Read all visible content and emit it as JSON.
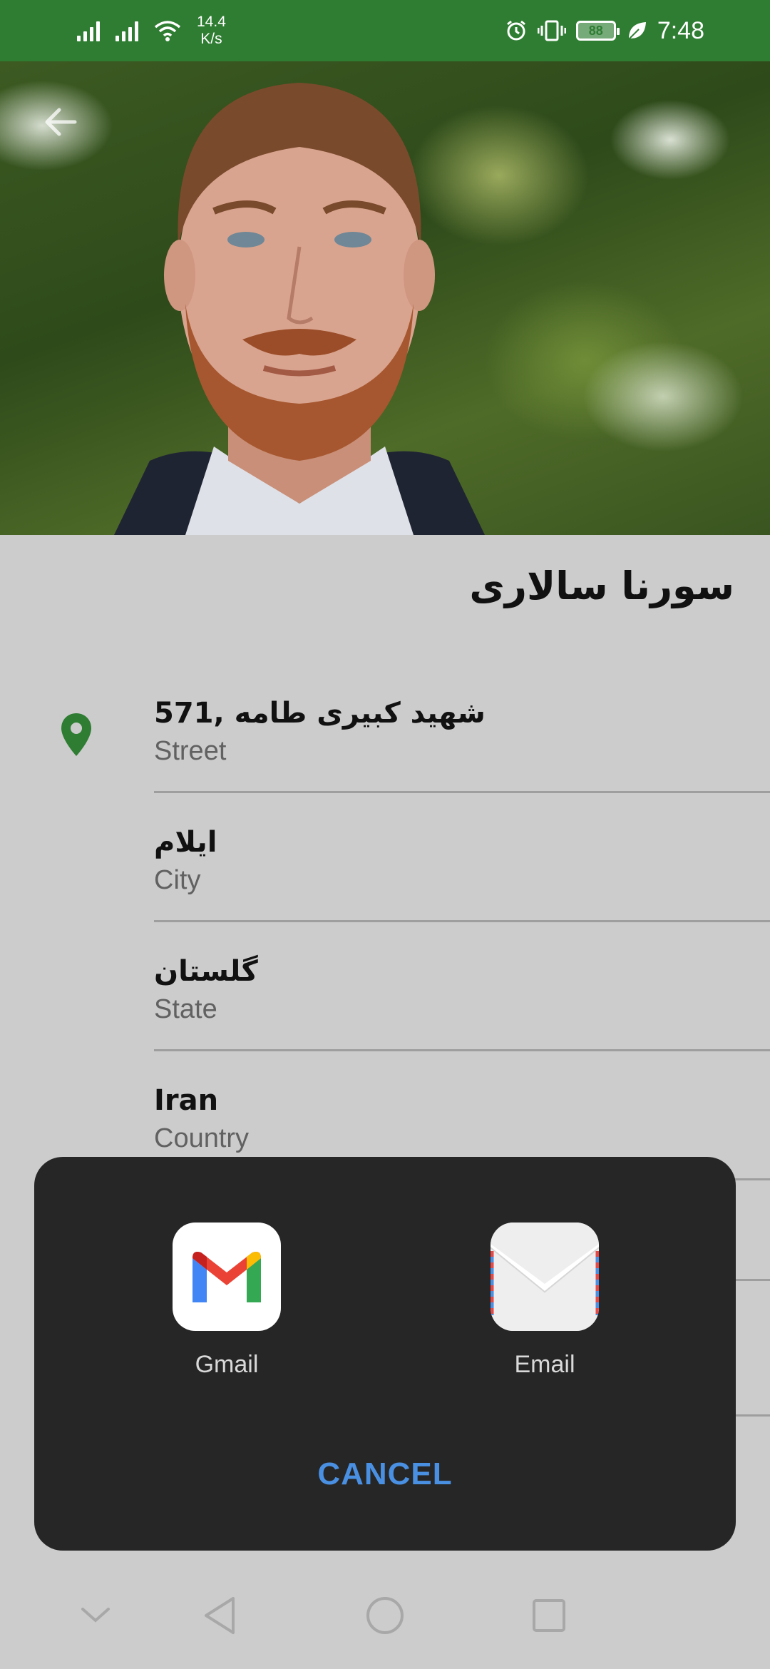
{
  "status_bar": {
    "net_speed_value": "14.4",
    "net_speed_unit": "K/s",
    "battery": "88",
    "time": "7:48"
  },
  "header": {
    "back_icon": "arrow-back-icon"
  },
  "contact": {
    "name": "سورنا سالاری",
    "fields": [
      {
        "value": "571, شهید کبیری طامه",
        "label": "Street",
        "icon": "location-pin-icon"
      },
      {
        "value": "ایلام",
        "label": "City"
      },
      {
        "value": "گلستان",
        "label": "State"
      },
      {
        "value": "Iran",
        "label": "Country"
      }
    ]
  },
  "share_sheet": {
    "apps": [
      {
        "label": "Gmail",
        "icon": "gmail-icon"
      },
      {
        "label": "Email",
        "icon": "email-envelope-icon"
      }
    ],
    "cancel_label": "CANCEL"
  },
  "colors": {
    "status_bar": "#2e7d32",
    "accent": "#2e7d32",
    "cancel": "#4a90e2",
    "sheet": "#262626"
  }
}
